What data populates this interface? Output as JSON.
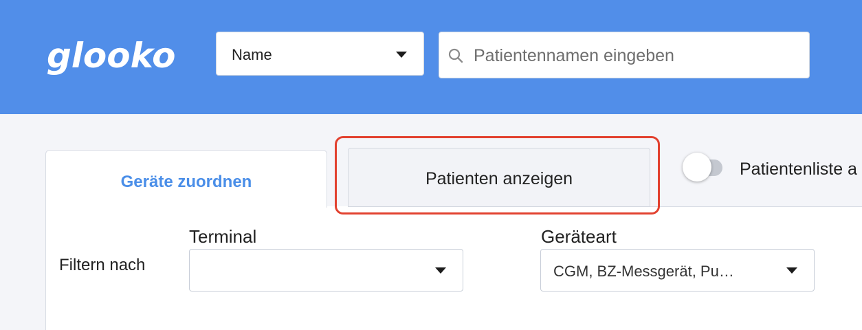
{
  "header": {
    "logo_text": "glooko",
    "search_type_select": {
      "selected": "Name"
    },
    "search": {
      "placeholder": "Patientennamen eingeben",
      "value": ""
    }
  },
  "tabs": [
    {
      "label": "Geräte zuordnen",
      "active": true
    },
    {
      "label": "Patienten anzeigen",
      "active": false
    }
  ],
  "toggle": {
    "label": "Patientenliste a",
    "on": false
  },
  "filters": {
    "label": "Filtern nach",
    "terminal": {
      "label": "Terminal",
      "value": ""
    },
    "device_type": {
      "label": "Geräteart",
      "value": "CGM, BZ-Messgerät, Pu…"
    }
  },
  "colors": {
    "header_bg": "#518ee9",
    "active_tab_text": "#4a8ee8",
    "highlight": "#e2412f",
    "page_bg": "#f4f5f9"
  }
}
